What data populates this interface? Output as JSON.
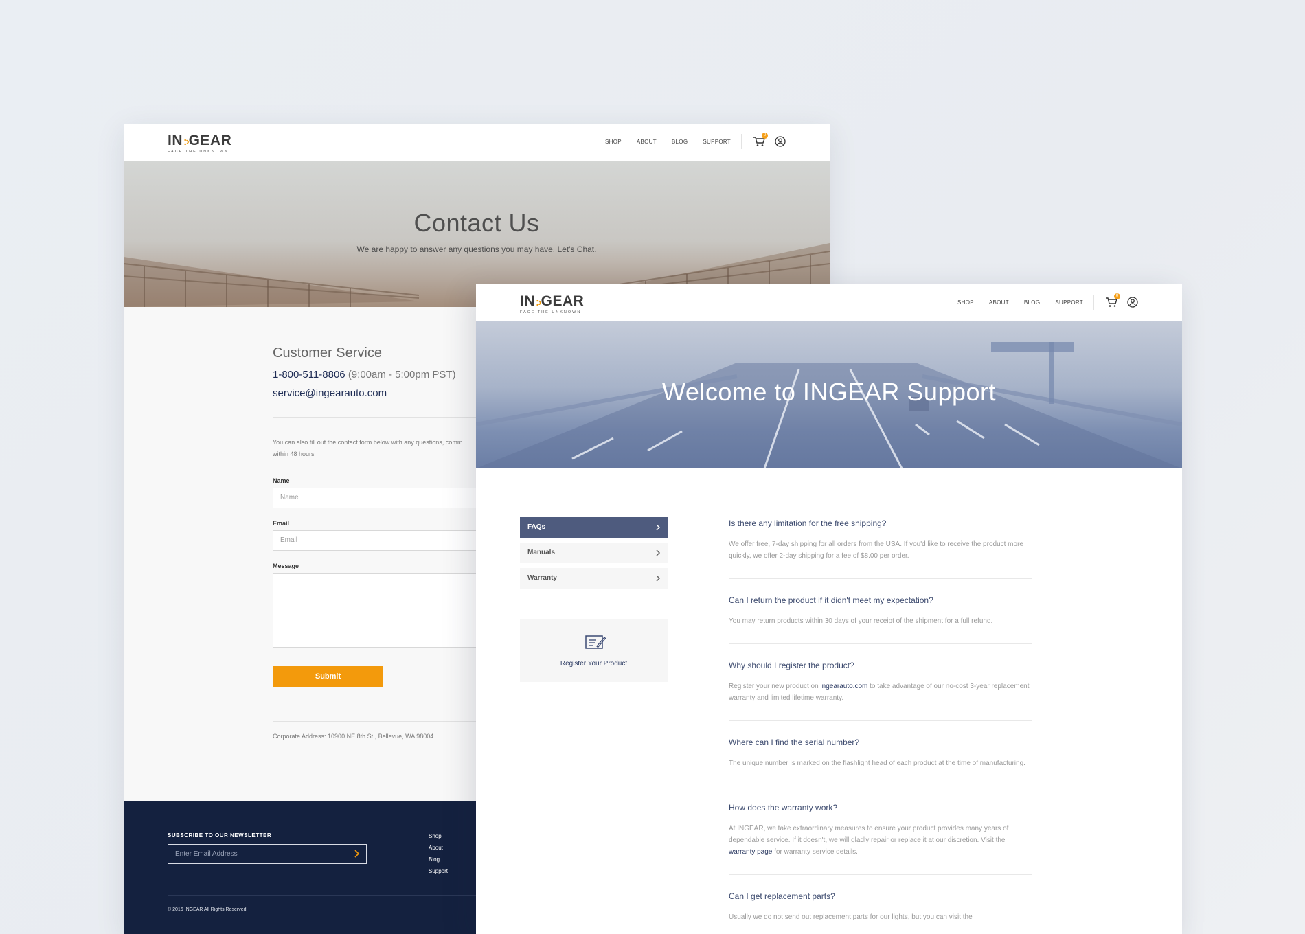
{
  "brand": {
    "logo_main_left": "IN",
    "logo_main_right": "GEAR",
    "logo_tagline": "FACE THE UNKNOWN",
    "accent_color": "#f39a0c",
    "navy_color": "#14213f"
  },
  "nav": {
    "items": [
      "SHOP",
      "ABOUT",
      "BLOG",
      "SUPPORT"
    ],
    "cart_count": "0",
    "cart_icon": "cart-icon",
    "user_icon": "user-icon"
  },
  "contact_page": {
    "hero_title": "Contact Us",
    "hero_subtitle": "We are happy to answer any questions you may have. Let's Chat.",
    "cs_title": "Customer Service",
    "phone": "1-800-511-8806",
    "hours": "(9:00am - 5:00pm PST)",
    "email": "service@ingearauto.com",
    "note_line1": "You can also fill out the contact form below with any questions, comm",
    "note_line2": "within 48 hours",
    "form": {
      "name_label": "Name",
      "name_placeholder": "Name",
      "email_label": "Email",
      "email_placeholder": "Email",
      "message_label": "Message",
      "message_placeholder": "",
      "submit_label": "Submit"
    },
    "corporate_address": "Corporate Address: 10900 NE 8th St., Bellevue, WA 98004",
    "footer": {
      "newsletter_title": "SUBSCRIBE TO OUR NEWSLETTER",
      "newsletter_placeholder": "Enter Email Address",
      "links": [
        "Shop",
        "About",
        "Blog",
        "Support"
      ],
      "copyright": "® 2016 INGEAR All Rights Reserved"
    }
  },
  "support_page": {
    "hero_title": "Welcome to INGEAR Support",
    "sidebar": [
      {
        "label": "FAQs",
        "active": true
      },
      {
        "label": "Manuals",
        "active": false
      },
      {
        "label": "Warranty",
        "active": false
      }
    ],
    "register_label": "Register Your Product",
    "faqs": [
      {
        "q": "Is there any limitation for the free shipping?",
        "a": "We offer free, 7-day shipping for all orders from the USA. If you'd like to receive the product more quickly, we offer 2-day shipping for a fee of $8.00 per order."
      },
      {
        "q": "Can I return the product if it didn't meet my expectation?",
        "a": "You may return products within 30 days of your receipt of the shipment for a full refund."
      },
      {
        "q": "Why should I register the product?",
        "a_pre": "Register your new product on ",
        "a_link": "ingearauto.com",
        "a_post": " to take advantage of our no-cost 3-year replacement warranty and limited lifetime warranty."
      },
      {
        "q": "Where can I find the serial number?",
        "a": "The unique number is marked on the flashlight head of each product at the time of manufacturing."
      },
      {
        "q": "How does the warranty work?",
        "a_pre": "At INGEAR, we take extraordinary measures to ensure your product provides many years of dependable service. If it doesn't, we will gladly repair or replace it at our discretion. Visit the ",
        "a_link": "warranty page",
        "a_post": " for warranty service details."
      },
      {
        "q": "Can I get replacement parts?",
        "a": "Usually we do not send out replacement parts for our lights, but you can visit the"
      }
    ]
  }
}
